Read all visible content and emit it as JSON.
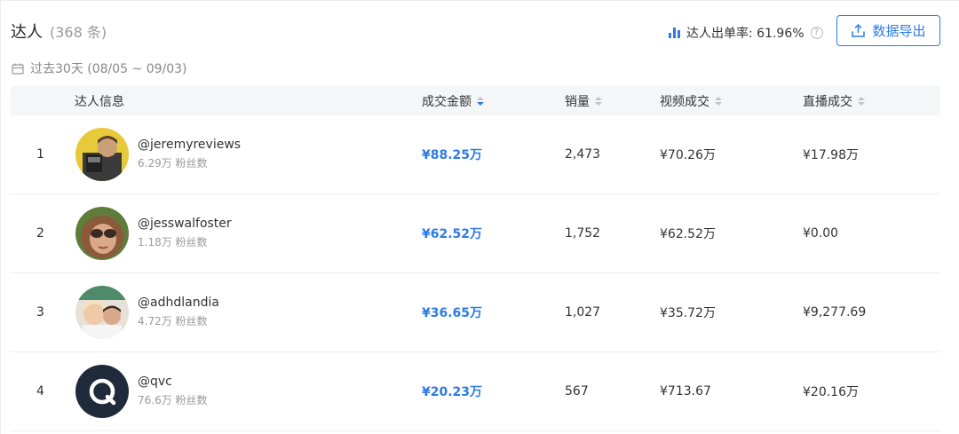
{
  "header": {
    "title": "达人",
    "count": "(368 条)",
    "rate_label": "达人出单率: 61.96%",
    "help_glyph": "?",
    "export_label": "数据导出"
  },
  "date_range": "过去30天 (08/05 ~ 09/03)",
  "table": {
    "columns": {
      "creator": "达人信息",
      "gmv": "成交金额",
      "sales": "销量",
      "video": "视频成交",
      "live": "直播成交"
    },
    "rows": [
      {
        "rank": "1",
        "handle": "@jeremyreviews",
        "fans": "6.29万 粉丝数",
        "gmv": "¥88.25万",
        "sales": "2,473",
        "video": "¥70.26万",
        "live": "¥17.98万"
      },
      {
        "rank": "2",
        "handle": "@jesswalfoster",
        "fans": "1.18万 粉丝数",
        "gmv": "¥62.52万",
        "sales": "1,752",
        "video": "¥62.52万",
        "live": "¥0.00"
      },
      {
        "rank": "3",
        "handle": "@adhdlandia",
        "fans": "4.72万 粉丝数",
        "gmv": "¥36.65万",
        "sales": "1,027",
        "video": "¥35.72万",
        "live": "¥9,277.69"
      },
      {
        "rank": "4",
        "handle": "@qvc",
        "fans": "76.6万 粉丝数",
        "gmv": "¥20.23万",
        "sales": "567",
        "video": "¥713.67",
        "live": "¥20.16万"
      }
    ]
  },
  "colors": {
    "accent": "#2d7be5",
    "header_bg": "#f5f6f8",
    "muted_text": "#999999"
  },
  "icons": {
    "rate": "bar-chart-icon",
    "help": "question-icon",
    "export": "upload-icon",
    "date": "calendar-icon",
    "sort": "sort-caret-icon"
  }
}
